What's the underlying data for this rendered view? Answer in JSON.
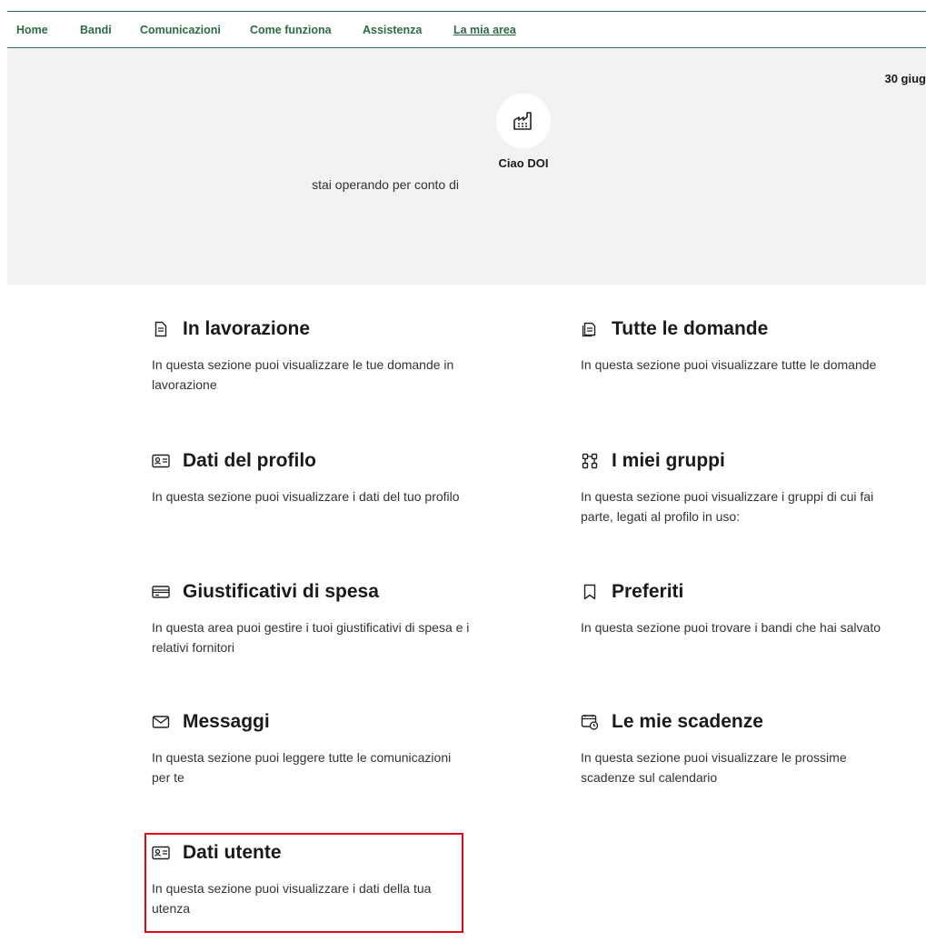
{
  "nav": {
    "items": [
      {
        "label": "Home"
      },
      {
        "label": "Bandi"
      },
      {
        "label": "Comunicazioni"
      },
      {
        "label": "Come funziona"
      },
      {
        "label": "Assistenza"
      },
      {
        "label": "La mia area",
        "active": true
      }
    ]
  },
  "hero": {
    "date": "30 giug",
    "avatar_icon": "factory-icon",
    "greeting": "Ciao DOI",
    "operating_for": "stai operando per conto di"
  },
  "sections": [
    {
      "title": "In lavorazione",
      "desc": "In questa sezione puoi visualizzare le tue domande in lavorazione",
      "icon": "document-icon"
    },
    {
      "title": "Tutte le domande",
      "desc": "In questa sezione puoi visualizzare tutte le domande",
      "icon": "documents-icon"
    },
    {
      "title": "Dati del profilo",
      "desc": "In questa sezione puoi visualizzare i dati del tuo profilo",
      "icon": "id-card-icon"
    },
    {
      "title": "I miei gruppi",
      "desc": "In questa sezione puoi visualizzare i gruppi di cui fai parte, legati al profilo in uso:",
      "icon": "groups-icon"
    },
    {
      "title": "Giustificativi di spesa",
      "desc": "In questa area puoi gestire i tuoi giustificativi di spesa e i relativi fornitori",
      "icon": "credit-card-icon"
    },
    {
      "title": "Preferiti",
      "desc": "In questa sezione puoi trovare i bandi che hai salvato",
      "icon": "bookmark-icon"
    },
    {
      "title": "Messaggi",
      "desc": "In questa sezione puoi leggere tutte le comunicazioni per te",
      "icon": "mail-icon"
    },
    {
      "title": "Le mie scadenze",
      "desc": "In questa sezione puoi visualizzare le prossime scadenze sul calendario",
      "icon": "calendar-icon"
    },
    {
      "title": "Dati utente",
      "desc": "In questa sezione puoi visualizzare i dati della tua utenza",
      "icon": "id-card-icon",
      "highlighted": true
    }
  ],
  "colors": {
    "nav_text": "#2d6a45",
    "hero_bg": "#f2f2f2",
    "highlight_border": "#e30613"
  }
}
